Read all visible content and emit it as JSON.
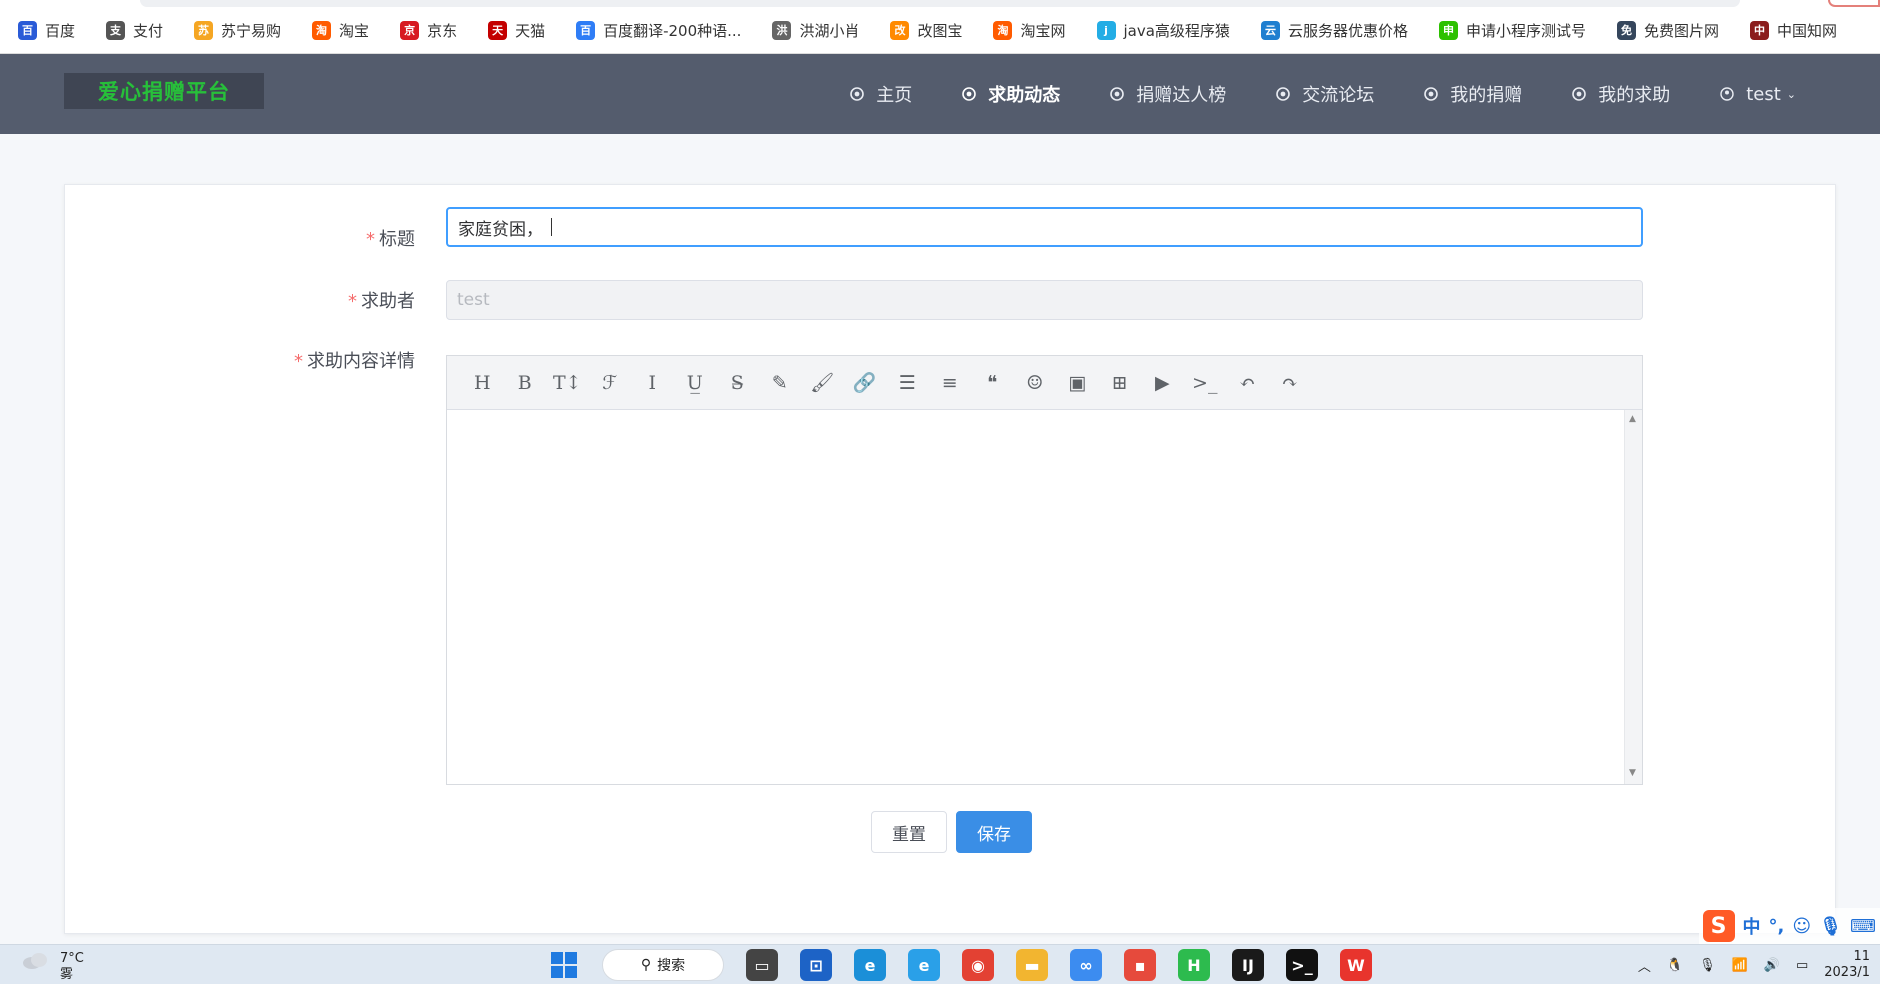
{
  "bookmarks": [
    {
      "label": "百度",
      "icon": "baidu-paw-icon",
      "color": "#2a5bd7"
    },
    {
      "label": "支付",
      "icon": "globe-icon",
      "color": "#555555"
    },
    {
      "label": "苏宁易购",
      "icon": "suning-lion-icon",
      "color": "#f5a623"
    },
    {
      "label": "淘宝",
      "icon": "taobao-icon",
      "color": "#ff5b00"
    },
    {
      "label": "京东",
      "icon": "jd-icon",
      "color": "#d71a21"
    },
    {
      "label": "天猫",
      "icon": "tmall-icon",
      "color": "#c40000"
    },
    {
      "label": "百度翻译-200种语...",
      "icon": "translate-icon",
      "color": "#2f7df6"
    },
    {
      "label": "洪湖小肖",
      "icon": "bird-icon",
      "color": "#666666"
    },
    {
      "label": "改图宝",
      "icon": "gaitubao-icon",
      "color": "#ff8a00"
    },
    {
      "label": "淘宝网",
      "icon": "taobao-icon",
      "color": "#ff5b00"
    },
    {
      "label": "java高级程序猿",
      "icon": "bilibili-icon",
      "color": "#23ade5"
    },
    {
      "label": "云服务器优惠价格",
      "icon": "cloud-icon",
      "color": "#1f7fd0"
    },
    {
      "label": "申请小程序测试号",
      "icon": "wechat-icon",
      "color": "#2dc100"
    },
    {
      "label": "免费图片网",
      "icon": "tumblr-icon",
      "color": "#35465c"
    },
    {
      "label": "中国知网",
      "icon": "cnki-icon",
      "color": "#8b1d1d"
    }
  ],
  "header": {
    "logo": "爱心捐赠平台",
    "nav": [
      {
        "label": "主页",
        "icon": "home-icon",
        "active": false
      },
      {
        "label": "求助动态",
        "icon": "compass-icon",
        "active": true
      },
      {
        "label": "捐赠达人榜",
        "icon": "grid-icon",
        "active": false
      },
      {
        "label": "交流论坛",
        "icon": "forum-icon",
        "active": false
      },
      {
        "label": "我的捐赠",
        "icon": "donate-icon",
        "active": false
      },
      {
        "label": "我的求助",
        "icon": "help-icon",
        "active": false
      }
    ],
    "user": "test"
  },
  "form": {
    "title_label": "标题",
    "title_value": "家庭贫困，",
    "requester_label": "求助者",
    "requester_value": "test",
    "content_label": "求助内容详情",
    "reset_label": "重置",
    "save_label": "保存",
    "toolbar": [
      {
        "name": "heading-icon",
        "glyph": "H"
      },
      {
        "name": "bold-icon",
        "glyph": "B"
      },
      {
        "name": "font-size-icon",
        "glyph": "T↕"
      },
      {
        "name": "font-family-icon",
        "glyph": "ℱ"
      },
      {
        "name": "italic-icon",
        "glyph": "I"
      },
      {
        "name": "underline-icon",
        "glyph": "U̲"
      },
      {
        "name": "strikethrough-icon",
        "glyph": "S̶"
      },
      {
        "name": "highlight-icon",
        "glyph": "✎"
      },
      {
        "name": "brush-icon",
        "glyph": "🖌"
      },
      {
        "name": "link-icon",
        "glyph": "🔗"
      },
      {
        "name": "bullet-list-icon",
        "glyph": "☰"
      },
      {
        "name": "align-icon",
        "glyph": "≡"
      },
      {
        "name": "quote-icon",
        "glyph": "❝"
      },
      {
        "name": "emoji-icon",
        "glyph": "☺"
      },
      {
        "name": "image-icon",
        "glyph": "▣"
      },
      {
        "name": "table-icon",
        "glyph": "⊞"
      },
      {
        "name": "video-icon",
        "glyph": "▶"
      },
      {
        "name": "code-icon",
        "glyph": ">_"
      },
      {
        "name": "undo-icon",
        "glyph": "↶"
      },
      {
        "name": "redo-icon",
        "glyph": "↷"
      }
    ]
  },
  "ime": {
    "lang": "中",
    "punct": "°,"
  },
  "taskbar": {
    "weather_temp": "7°C",
    "weather_desc": "雾",
    "search_label": "搜索",
    "apps": [
      {
        "name": "task-view-icon",
        "color": "#444444",
        "glyph": "▭"
      },
      {
        "name": "network-app-icon",
        "color": "#1d63c6",
        "glyph": "⊡"
      },
      {
        "name": "edge-icon",
        "color": "#1b8fd8",
        "glyph": "e"
      },
      {
        "name": "ie-icon",
        "color": "#2aa0e8",
        "glyph": "e"
      },
      {
        "name": "chrome-icon",
        "color": "#e34133",
        "glyph": "◉"
      },
      {
        "name": "folder-icon",
        "color": "#f2b530",
        "glyph": "▬"
      },
      {
        "name": "draw-icon",
        "color": "#3c8cf0",
        "glyph": "∞"
      },
      {
        "name": "paint-icon",
        "color": "#e64a3c",
        "glyph": "▪"
      },
      {
        "name": "hbuilder-icon",
        "color": "#2dbb4e",
        "glyph": "H"
      },
      {
        "name": "intellij-icon",
        "color": "#1a1a1a",
        "glyph": "IJ"
      },
      {
        "name": "terminal-icon",
        "color": "#111111",
        "glyph": ">_"
      },
      {
        "name": "wps-icon",
        "color": "#e8342d",
        "glyph": "W"
      }
    ],
    "clock_time": "11",
    "clock_date": "2023/1"
  }
}
